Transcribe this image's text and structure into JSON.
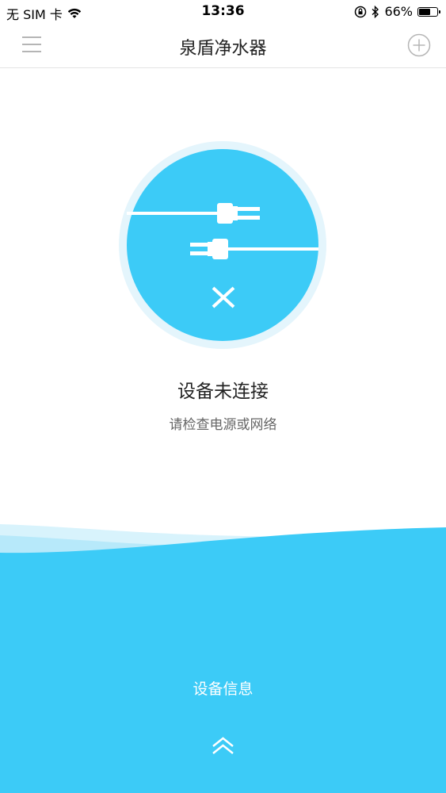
{
  "status_bar": {
    "carrier": "无 SIM 卡",
    "time": "13:36",
    "battery_percent": "66%",
    "battery_level": 0.66,
    "icons": [
      "wifi-icon",
      "rotation-lock-icon",
      "bluetooth-icon",
      "battery-icon"
    ]
  },
  "nav": {
    "title": "泉盾净水器",
    "left_icon": "menu-icon",
    "right_icon": "add-circle-icon"
  },
  "device_status": {
    "illustration_icon": "unplugged-icon",
    "title": "设备未连接",
    "subtitle": "请检查电源或网络"
  },
  "bottom_panel": {
    "label": "设备信息",
    "expand_icon": "double-chevron-up-icon"
  },
  "colors": {
    "accent": "#3ccbf7",
    "circle_ring": "#e4f5fc",
    "wave_light": "#b7e9fa",
    "nav_icon": "#b5b5b5"
  }
}
